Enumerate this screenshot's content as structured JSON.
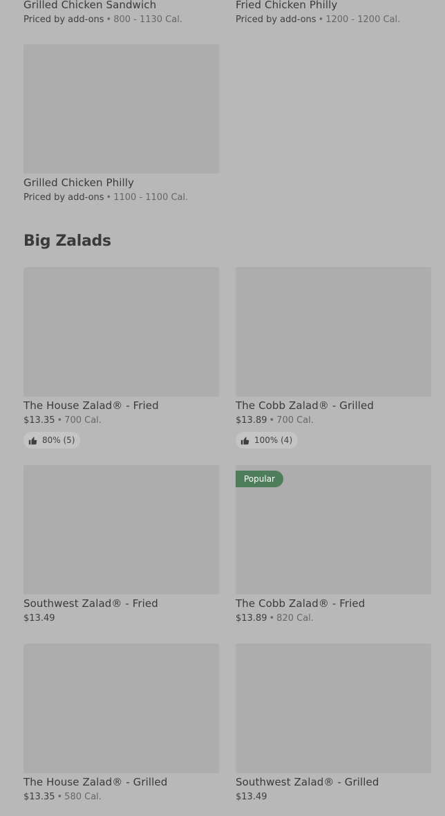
{
  "top_items": [
    {
      "name": "Grilled Chicken Sandwich",
      "price": "Priced by add-ons",
      "calories": "800 - 1130 Cal."
    },
    {
      "name": "Fried Chicken Philly",
      "price": "Priced by add-ons",
      "calories": "1200 - 1200 Cal."
    },
    {
      "name": "Grilled Chicken Philly",
      "price": "Priced by add-ons",
      "calories": "1100 - 1100 Cal."
    }
  ],
  "section": {
    "title": "Big Zalads"
  },
  "separator": "•",
  "items": [
    {
      "name": "The House Zalad® - Fried",
      "price": "$13.35",
      "calories": "700 Cal.",
      "rating": "80% (5)"
    },
    {
      "name": "The Cobb Zalad® - Grilled",
      "price": "$13.89",
      "calories": "700 Cal.",
      "rating": "100% (4)"
    },
    {
      "name": "Southwest Zalad® - Fried",
      "price": "$13.49"
    },
    {
      "name": "The Cobb Zalad® - Fried",
      "price": "$13.89",
      "calories": "820 Cal.",
      "badge": "Popular"
    },
    {
      "name": "The House Zalad® - Grilled",
      "price": "$13.35",
      "calories": "580 Cal."
    },
    {
      "name": "Southwest Zalad® - Grilled",
      "price": "$13.49"
    }
  ],
  "colors": {
    "overlay": "#b8b8b8",
    "placeholder": "#adadad",
    "badge": "#4d7d5a"
  },
  "icons": {
    "rating": "thumbs-up-icon"
  }
}
